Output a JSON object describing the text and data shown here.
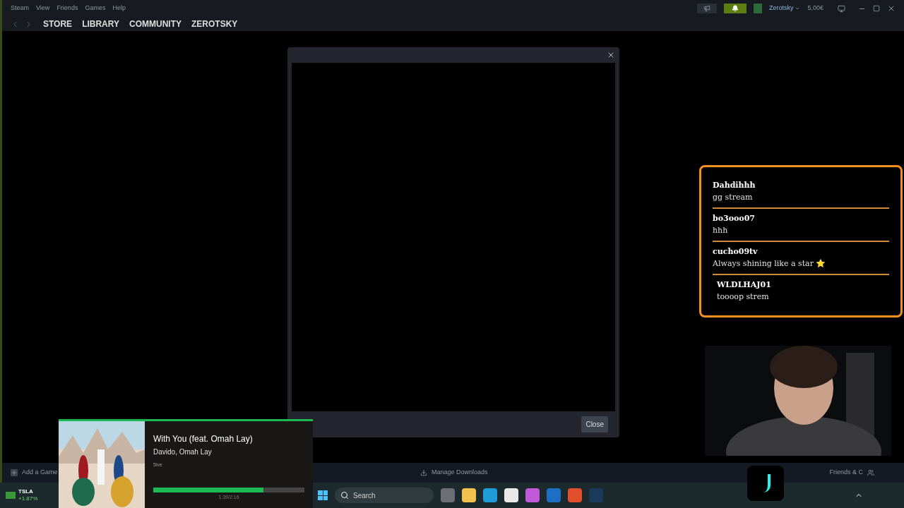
{
  "menu": [
    "Steam",
    "View",
    "Friends",
    "Games",
    "Help"
  ],
  "nav_tabs": [
    "STORE",
    "LIBRARY",
    "COMMUNITY",
    "ZEROTSKY"
  ],
  "account": {
    "name": "Zerotsky",
    "balance": "5,00€"
  },
  "dialog": {
    "close_button": "Close"
  },
  "chat": {
    "messages": [
      {
        "user": "Dahdihhh",
        "text": "gg stream"
      },
      {
        "user": "bo3ooo07",
        "text": "hhh"
      },
      {
        "user": "cucho09tv",
        "text": "Always shining like a star ⭐"
      },
      {
        "user": "WLDLHAJ01",
        "text": "toooop strem"
      }
    ]
  },
  "music": {
    "title": "With You (feat. Omah Lay)",
    "artist": "Davido, Omah Lay",
    "album": "5ive",
    "time": "1:39/2:16",
    "level": 0.73
  },
  "footer": {
    "add_game": "Add a Game",
    "downloads": "Manage Downloads",
    "friends": "Friends & C"
  },
  "ticker": {
    "symbol": "TSLA",
    "change": "+1.87%"
  },
  "taskbar": {
    "search_placeholder": "Search"
  }
}
